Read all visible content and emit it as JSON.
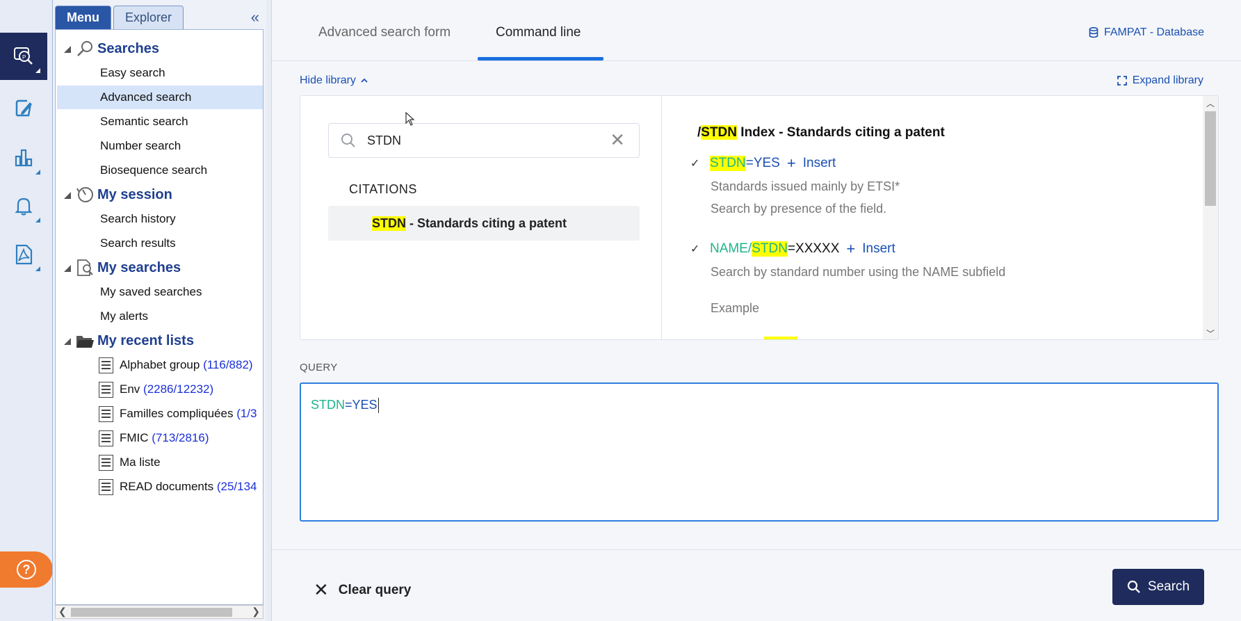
{
  "rail": {
    "items": [
      {
        "name": "patent-search",
        "active": true
      },
      {
        "name": "edit"
      },
      {
        "name": "analytics"
      },
      {
        "name": "alerts"
      },
      {
        "name": "pdf"
      }
    ],
    "help_label": "?"
  },
  "sidebar": {
    "tabs": [
      {
        "label": "Menu",
        "active": true
      },
      {
        "label": "Explorer",
        "active": false
      }
    ],
    "collapse_label": "«",
    "sections": [
      {
        "label": "Searches",
        "icon": "magnifier-icon",
        "items": [
          "Easy search",
          "Advanced search",
          "Semantic search",
          "Number search",
          "Biosequence search"
        ]
      },
      {
        "label": "My session",
        "icon": "clock-icon",
        "items": [
          "Search history",
          "Search results"
        ]
      },
      {
        "label": "My searches",
        "icon": "saved-search-icon",
        "items": [
          "My saved searches",
          "My alerts"
        ]
      },
      {
        "label": "My recent lists",
        "icon": "folder-icon",
        "items": [
          {
            "name": "Alphabet group",
            "count": "(116/882)"
          },
          {
            "name": "Env",
            "count": "(2286/12232)"
          },
          {
            "name": "Familles compliquées",
            "count": "(1/3"
          },
          {
            "name": "FMIC",
            "count": "(713/2816)"
          },
          {
            "name": "Ma liste",
            "count": ""
          },
          {
            "name": "READ documents",
            "count": "(25/134"
          }
        ]
      }
    ],
    "selected_item": "Advanced search"
  },
  "main": {
    "tabs": [
      {
        "label": "Advanced search form",
        "active": false
      },
      {
        "label": "Command line",
        "active": true
      }
    ],
    "database_label": "FAMPAT - Database",
    "hide_library_label": "Hide library",
    "expand_library_label": "Expand library",
    "library": {
      "search_value": "STDN",
      "category_heading": "CITATIONS",
      "result": {
        "code": "STDN",
        "text": " - Standards citing a patent"
      },
      "index_title_prefix": "/",
      "index_title_code": "STDN",
      "index_title_text": " Index - Standards citing a patent",
      "entries": [
        {
          "prefix": "",
          "code": "STDN",
          "suffix": "=YES",
          "insert_label": "Insert",
          "descriptions": [
            "Standards issued mainly by ETSI*",
            "Search by presence of the field."
          ]
        },
        {
          "prefix": "NAME/",
          "code": "STDN",
          "suffix": "=XXXXX",
          "insert_label": "Insert",
          "descriptions": [
            "Search by standard number using the NAME subfield"
          ]
        }
      ],
      "example_label": "Example"
    },
    "query_label": "QUERY",
    "query": {
      "field": "STDN",
      "operator": "=",
      "value": "YES"
    },
    "clear_query_label": "Clear query",
    "search_button_label": "Search"
  },
  "colors": {
    "accent": "#1a4fb3",
    "navy": "#1e2b5c",
    "field_green": "#1db58a",
    "highlight": "#ffff00",
    "help_orange": "#f07a2e"
  }
}
